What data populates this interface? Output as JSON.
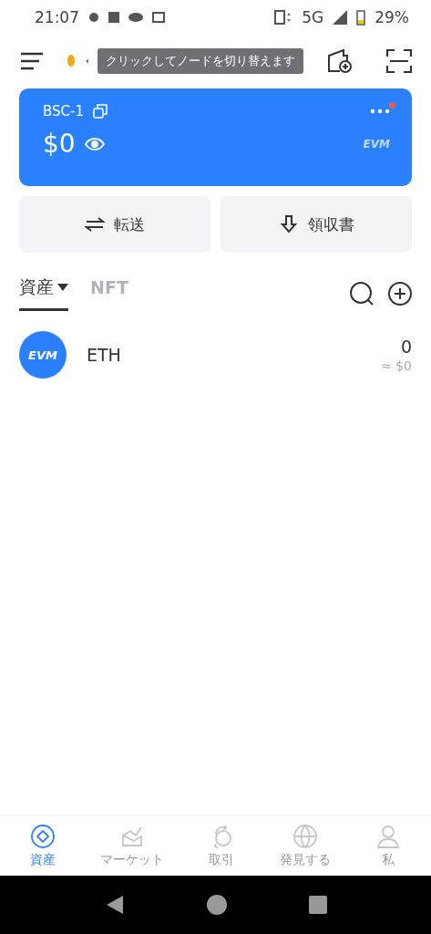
{
  "status_bar": {
    "time": "21:07",
    "network": "5G",
    "battery": "29%"
  },
  "header": {
    "tooltip": "クリックしてノードを切り替えます"
  },
  "wallet": {
    "name": "BSC-1",
    "balance": "$0",
    "chain_badge": "EVM",
    "notification": true
  },
  "actions": [
    {
      "kind": "transfer",
      "label": "転送"
    },
    {
      "kind": "receive",
      "label": "領収書"
    }
  ],
  "tabs": [
    {
      "label": "資産",
      "selected": true
    },
    {
      "label": "NFT",
      "selected": false
    }
  ],
  "assets": [
    {
      "symbol": "ETH",
      "logo_text": "EVM",
      "amount": "0",
      "value": "≈ $0"
    }
  ],
  "nav": [
    {
      "kind": "assets",
      "label": "資産",
      "selected": true
    },
    {
      "kind": "market",
      "label": "マーケット",
      "selected": false
    },
    {
      "kind": "trade",
      "label": "取引",
      "selected": false
    },
    {
      "kind": "discover",
      "label": "発見する",
      "selected": false
    },
    {
      "kind": "me",
      "label": "私",
      "selected": false
    }
  ]
}
